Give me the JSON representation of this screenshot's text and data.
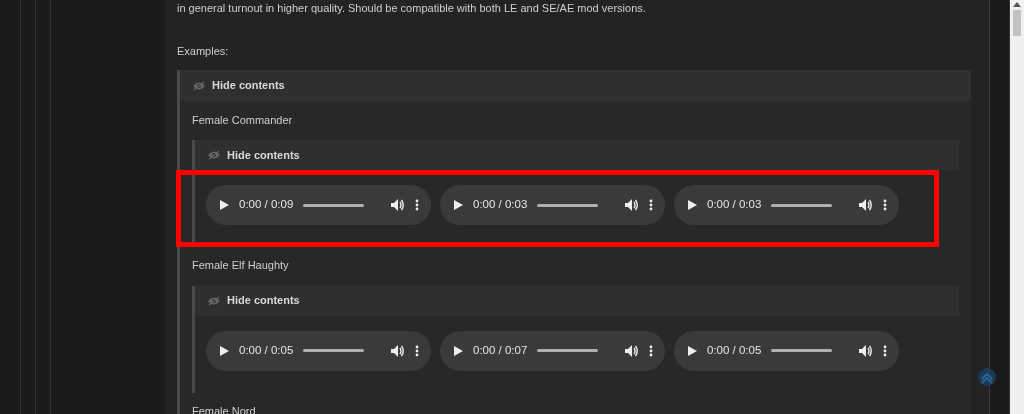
{
  "intro_text": "in general turnout in higher quality. Should be compatible with both LE and SE/AE mod versions.",
  "examples_label": "Examples:",
  "spoiler": {
    "header": "Hide contents",
    "sections": [
      {
        "title": "Female Commander",
        "spoiler": {
          "header": "Hide contents",
          "highlighted": true,
          "players": [
            {
              "time": "0:00 / 0:09"
            },
            {
              "time": "0:00 / 0:03"
            },
            {
              "time": "0:00 / 0:03"
            }
          ]
        }
      },
      {
        "title": "Female Elf Haughty",
        "spoiler": {
          "header": "Hide contents",
          "highlighted": false,
          "players": [
            {
              "time": "0:00 / 0:05"
            },
            {
              "time": "0:00 / 0:07"
            },
            {
              "time": "0:00 / 0:05"
            }
          ]
        }
      },
      {
        "title": "Female Nord"
      }
    ]
  }
}
